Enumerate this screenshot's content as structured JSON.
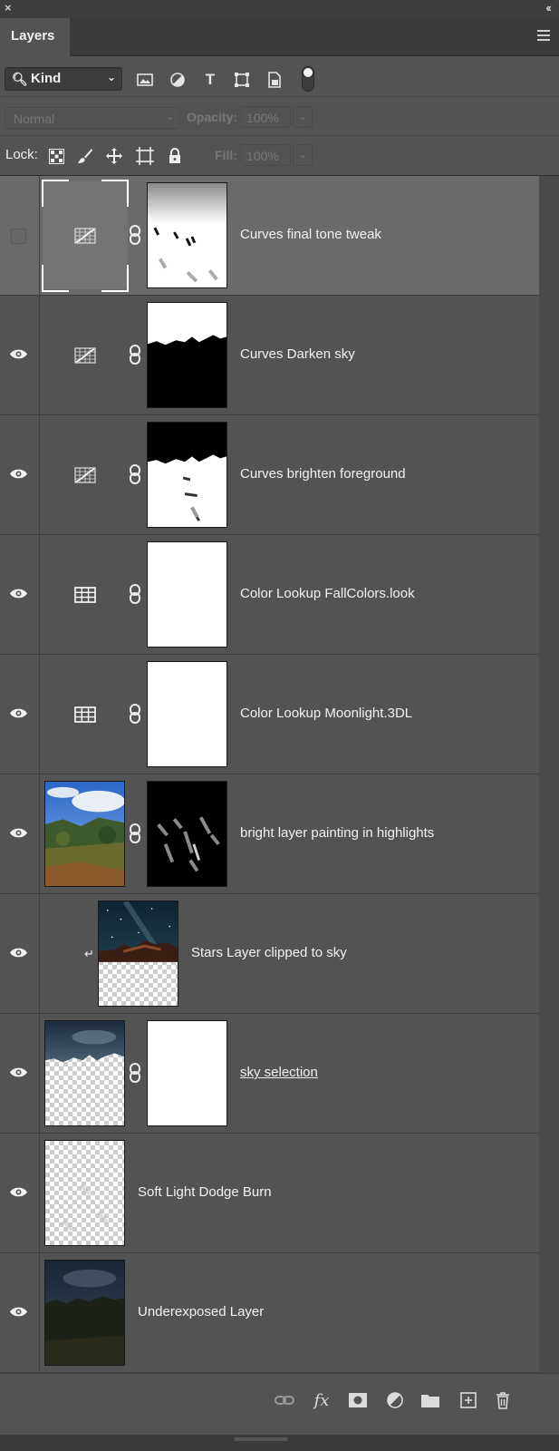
{
  "panel": {
    "close_glyph": "×",
    "collapse_glyph": "‹‹",
    "tab_label": "Layers"
  },
  "filter": {
    "kind_label": "Kind",
    "icons": [
      "image-filter-icon",
      "adjustment-filter-icon",
      "type-filter-icon",
      "shape-filter-icon",
      "smart-object-filter-icon",
      "filter-toggle"
    ]
  },
  "blend": {
    "mode": "Normal",
    "opacity_label": "Opacity:",
    "opacity_value": "100%",
    "fill_label": "Fill:",
    "fill_value": "100%"
  },
  "lock": {
    "label": "Lock:",
    "icons": [
      "lock-transparent-pixels-icon",
      "lock-image-pixels-icon",
      "lock-position-icon",
      "lock-artboard-icon",
      "lock-all-icon"
    ]
  },
  "layers": [
    {
      "name": "Curves final tone tweak",
      "type": "curves",
      "visible": false,
      "selected": true,
      "mask": "mask-final-tweak"
    },
    {
      "name": "Curves Darken sky",
      "type": "curves",
      "visible": true,
      "selected": false,
      "mask": "mask-darken-sky"
    },
    {
      "name": "Curves brighten foreground",
      "type": "curves",
      "visible": true,
      "selected": false,
      "mask": "mask-brighten-fg"
    },
    {
      "name": "Color Lookup FallColors.look",
      "type": "color-lookup",
      "visible": true,
      "selected": false,
      "mask": "mask-white"
    },
    {
      "name": "Color Lookup Moonlight.3DL",
      "type": "color-lookup",
      "visible": true,
      "selected": false,
      "mask": "mask-white"
    },
    {
      "name": "bright layer painting in highlights",
      "type": "pixel",
      "visible": true,
      "selected": false,
      "mask": "mask-highlights"
    },
    {
      "name": "Stars Layer clipped to sky",
      "type": "clipped",
      "visible": true,
      "selected": false
    },
    {
      "name": "sky selection",
      "type": "pixel",
      "visible": true,
      "selected": false,
      "mask": "mask-white",
      "underlined": true
    },
    {
      "name": "Soft Light Dodge Burn",
      "type": "pixel-transparent",
      "visible": true,
      "selected": false
    },
    {
      "name": "Underexposed Layer",
      "type": "pixel",
      "visible": true,
      "selected": false
    }
  ],
  "footer": {
    "icons": [
      "link-layers-icon",
      "layer-style-fx-icon",
      "add-mask-icon",
      "new-adjustment-icon",
      "new-group-icon",
      "new-layer-icon",
      "delete-layer-icon"
    ],
    "fx_label": "fx"
  },
  "colors": {
    "panel_bg": "#535353",
    "selected_row": "#6a6a6a",
    "header_bg": "#3b3b3b"
  }
}
